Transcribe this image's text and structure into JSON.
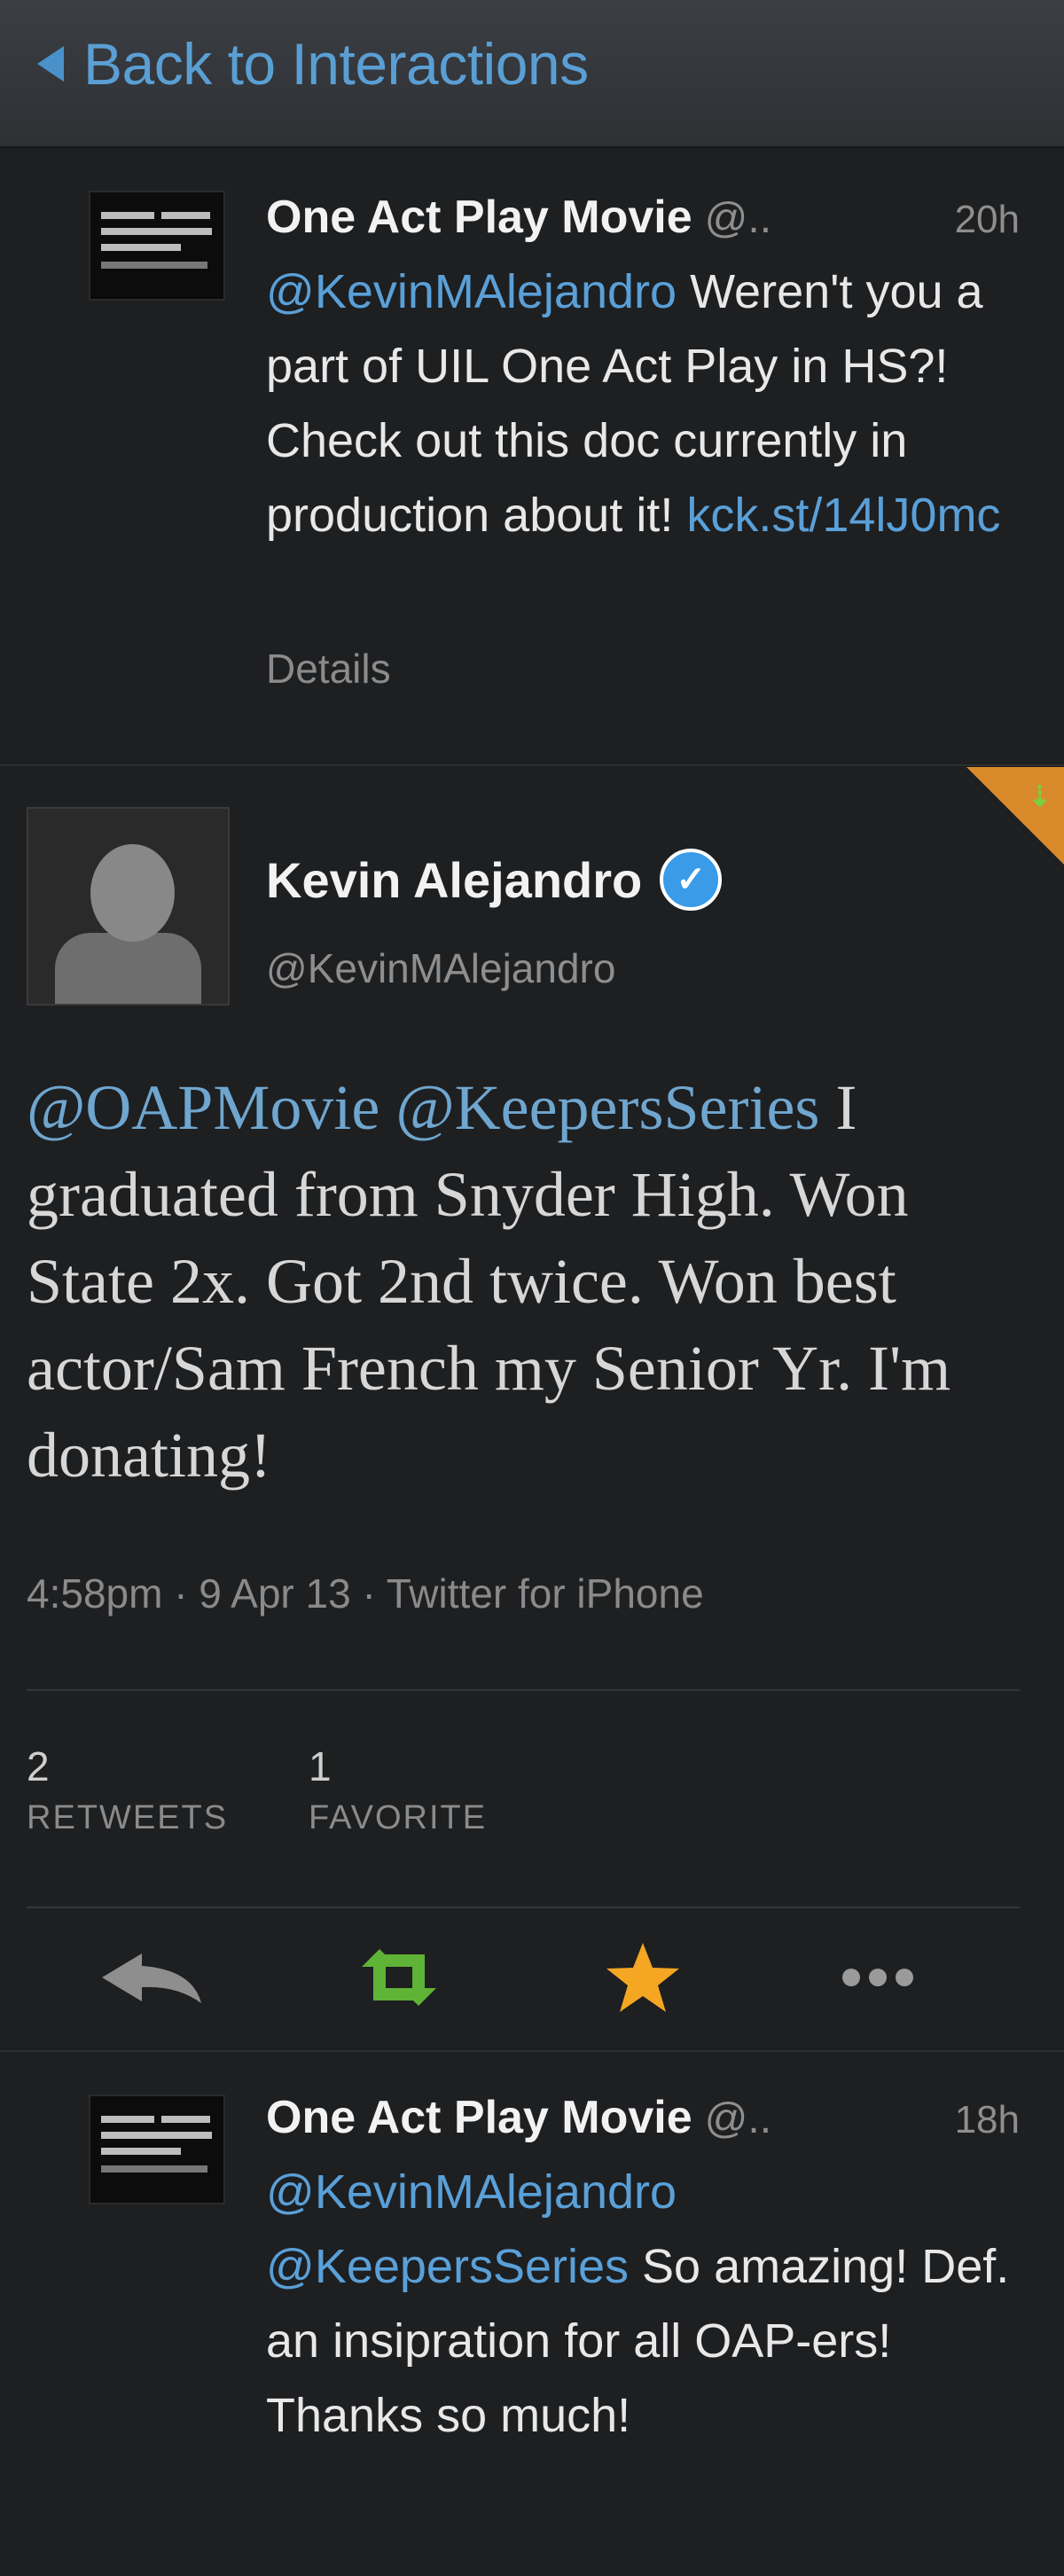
{
  "header": {
    "back_label": "Back to Interactions"
  },
  "tweets": [
    {
      "name": "One Act Play Movie",
      "handle_trunc": "@..",
      "time": "20h",
      "mention": "@KevinMAlejandro",
      "text": "Weren't you a part of UIL One Act Play in HS?! Check out this doc currently in production about it!",
      "link": "kck.st/14lJ0mc",
      "details": "Details"
    },
    {
      "name": "One Act Play Movie",
      "handle_trunc": "@..",
      "time": "18h",
      "mention1": "@KevinMAlejandro",
      "mention2": "@KeepersSeries",
      "text": "So amazing! Def. an insipration for all OAP-ers! Thanks so much!"
    }
  ],
  "main_tweet": {
    "name": "Kevin Alejandro",
    "handle": "@KevinMAlejandro",
    "mention1": "@OAPMovie",
    "mention2": "@KeepersSeries",
    "text": "I graduated from Snyder High. Won State 2x. Got 2nd twice. Won best actor/Sam French my Senior Yr. I'm donating!",
    "meta": "4:58pm · 9 Apr 13 · Twitter for iPhone",
    "retweets_count": "2",
    "retweets_label": "RETWEETS",
    "favorites_count": "1",
    "favorites_label": "FAVORITE",
    "icons": [
      "reply-icon",
      "retweet-icon",
      "favorite-star-icon",
      "more-icon"
    ],
    "colors": {
      "retweet": "#5fb336",
      "favorite": "#f5a623",
      "link": "#5aa0d8",
      "verified": "#3a9be8"
    }
  }
}
